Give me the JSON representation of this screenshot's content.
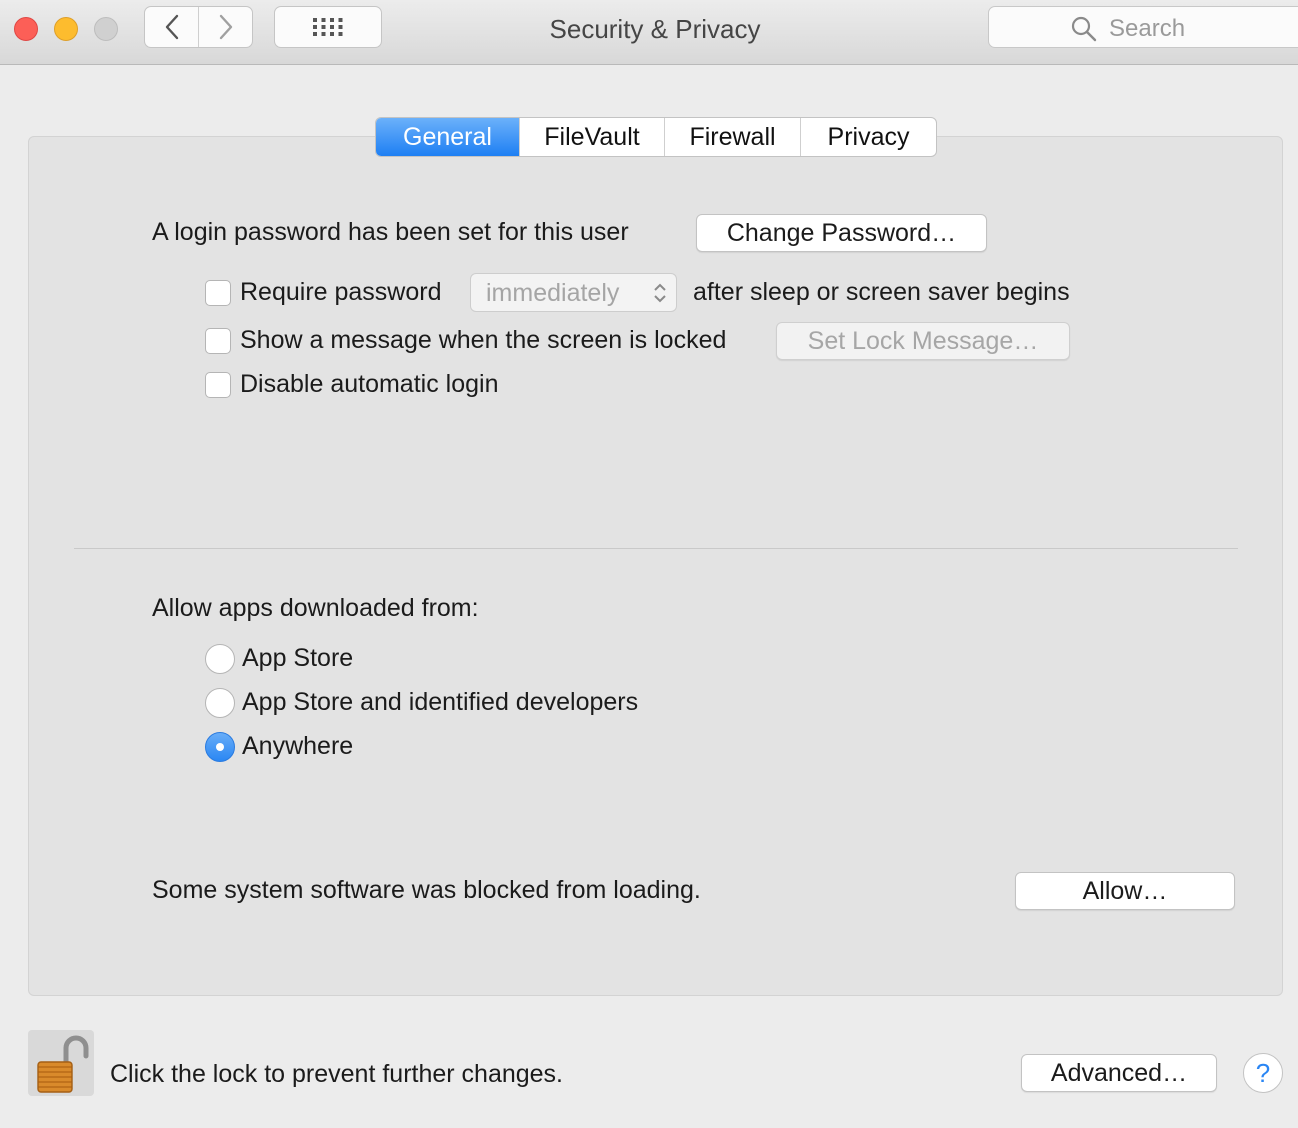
{
  "window": {
    "title": "Security & Privacy",
    "search_placeholder": "Search"
  },
  "tabs": [
    {
      "label": "General",
      "active": true
    },
    {
      "label": "FileVault",
      "active": false
    },
    {
      "label": "Firewall",
      "active": false
    },
    {
      "label": "Privacy",
      "active": false
    }
  ],
  "general": {
    "login_password_text": "A login password has been set for this user",
    "change_password_label": "Change Password…",
    "require_password_label": "Require password",
    "require_password_checked": false,
    "require_password_delay": "immediately",
    "after_sleep_text": "after sleep or screen saver begins",
    "show_message_label": "Show a message when the screen is locked",
    "show_message_checked": false,
    "set_lock_message_label": "Set Lock Message…",
    "disable_auto_login_label": "Disable automatic login",
    "disable_auto_login_checked": false
  },
  "allow_apps": {
    "heading": "Allow apps downloaded from:",
    "options": [
      {
        "label": "App Store",
        "selected": false
      },
      {
        "label": "App Store and identified developers",
        "selected": false
      },
      {
        "label": "Anywhere",
        "selected": true
      }
    ]
  },
  "blocked": {
    "text": "Some system software was blocked from loading.",
    "allow_label": "Allow…"
  },
  "footer": {
    "lock_text": "Click the lock to prevent further changes.",
    "advanced_label": "Advanced…",
    "help_glyph": "?"
  },
  "colors": {
    "accent": "#2a87f3",
    "close": "#fc5f57",
    "minimize": "#fdbc2e",
    "zoom_disabled": "#d0d0d0"
  },
  "icons": [
    "back-chevron-icon",
    "forward-chevron-icon",
    "grid-icon",
    "search-icon",
    "up-down-chevron-icon",
    "unlocked-padlock-icon",
    "help-icon"
  ]
}
